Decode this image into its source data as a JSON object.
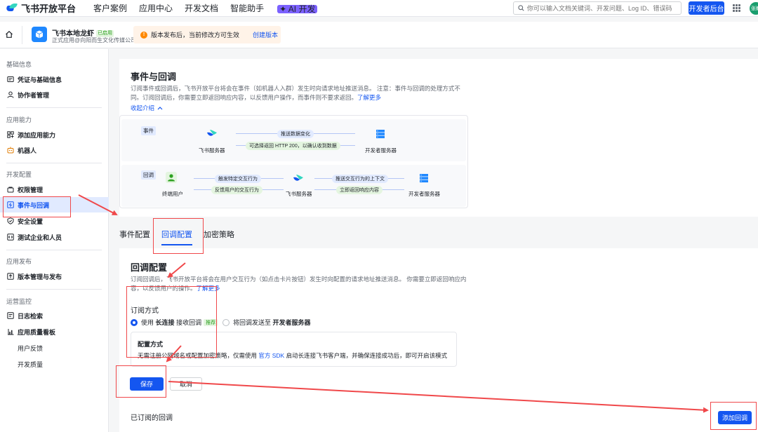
{
  "topbar": {
    "brand": "飞书开放平台",
    "nav": [
      "客户案例",
      "应用中心",
      "开发文档",
      "智能助手"
    ],
    "ai_badge": "✦ AI 开发",
    "search_placeholder": "你可以输入文档关键词、开发问题、Log ID、错误码",
    "dev_console": "开发者后台",
    "avatar_text": "张巍"
  },
  "appbar": {
    "app_name": "飞书本地龙虾",
    "status": "已启用",
    "app_sub": "正式应用@向阳而生文化传媒公司",
    "notice": "版本发布后，当前修改方可生效",
    "notice_link": "创建版本"
  },
  "sidebar": {
    "sections": [
      {
        "title": "基础信息",
        "items": [
          "凭证与基础信息",
          "协作者管理"
        ]
      },
      {
        "title": "应用能力",
        "items": [
          "添加应用能力",
          "机器人"
        ]
      },
      {
        "title": "开发配置",
        "items": [
          "权限管理",
          "事件与回调",
          "安全设置",
          "测试企业和人员"
        ]
      },
      {
        "title": "应用发布",
        "items": [
          "版本管理与发布"
        ]
      },
      {
        "title": "运营监控",
        "items": [
          "日志检索",
          "应用质量看板",
          "用户反馈",
          "开发质量"
        ]
      }
    ],
    "active_item": "事件与回调"
  },
  "events_card": {
    "title": "事件与回调",
    "desc_line1": "订阅事件或回调后，飞书开放平台将会在事件（如机器人入群）发生时向请求地址推送消息。 注意：事件与回调的处理方式不",
    "desc_line2": "同。订阅回调后，你需要立即返回响应内容，以反馈用户操作，而事件则不要求返回。",
    "learn_more": "了解更多",
    "collapse": "收起介绍",
    "diagram": {
      "event_tag": "事件",
      "callback_tag": "回调",
      "feishu_server": "飞书服务器",
      "dev_server": "开发者服务器",
      "end_user": "终端用户",
      "event_push": "推送数据变化",
      "event_return": "可选择返回 HTTP 200，以确认收到数据",
      "cb_trigger": "触发特定交互行为",
      "cb_feedback": "反馈用户的交互行为",
      "cb_push": "推送交互行为的上下文",
      "cb_return": "立即返回响应内容"
    }
  },
  "tabs": [
    "事件配置",
    "回调配置",
    "加密策略"
  ],
  "active_tab": "回调配置",
  "callback_card": {
    "title": "回调配置",
    "desc_line1": "订阅回调后，飞书开放平台将会在用户交互行为（如点击卡片按钮）发生时向配置的请求地址推送消息。 你需要立即返回响应内",
    "desc_line2": "容，以反馈用户的操作。",
    "learn_more": "了解更多",
    "sub_method_title": "订阅方式",
    "option1_prefix": "使用",
    "option1_bold": "长连接",
    "option1_suffix": "接收回调",
    "option1_badge": "推荐",
    "option2_prefix": "将回调发送至",
    "option2_bold": "开发者服务器",
    "config_title": "配置方式",
    "config_desc_a": "无需注册公网域名或配置加密策略，仅需使用",
    "config_link": "官方 SDK",
    "config_desc_b": "启动长连接飞书客户端，并确保连接成功后，即可开启该模式",
    "save": "保存",
    "cancel": "取消",
    "subscribed_title": "已订阅的回调",
    "add_callback": "添加回调"
  },
  "colors": {
    "brand": "#1456f0",
    "annotation": "#f0484a"
  }
}
